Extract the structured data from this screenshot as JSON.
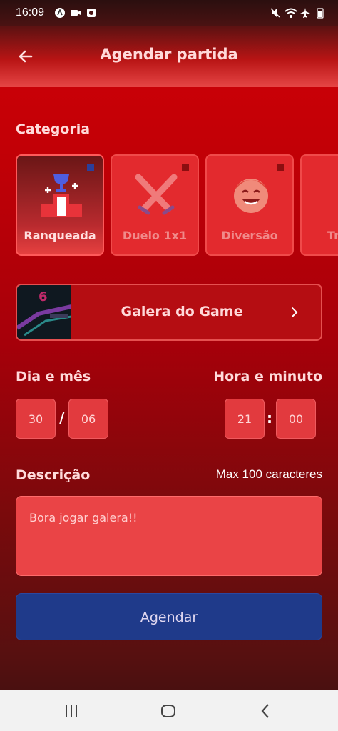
{
  "status": {
    "time": "16:09"
  },
  "header": {
    "title": "Agendar partida"
  },
  "category": {
    "label": "Categoria",
    "items": [
      {
        "label": "Ranqueada",
        "icon": "trophy-podium-icon",
        "selected": true
      },
      {
        "label": "Duelo 1x1",
        "icon": "crossed-swords-icon",
        "selected": false
      },
      {
        "label": "Diversão",
        "icon": "laughing-face-icon",
        "selected": false
      },
      {
        "label": "Tr",
        "icon": "person-icon",
        "selected": false
      }
    ]
  },
  "group": {
    "name": "Galera do Game"
  },
  "date": {
    "label": "Dia e mês",
    "day": "30",
    "month": "06",
    "separator": "/"
  },
  "time": {
    "label": "Hora e minuto",
    "hour": "21",
    "minute": "00",
    "separator": ":"
  },
  "description": {
    "label": "Descrição",
    "max": "Max 100 caracteres",
    "value": "Bora jogar galera!!"
  },
  "submit": {
    "label": "Agendar"
  },
  "colors": {
    "accent": "#e23a3e",
    "button": "#1f3a8a",
    "background": "#c30006"
  }
}
